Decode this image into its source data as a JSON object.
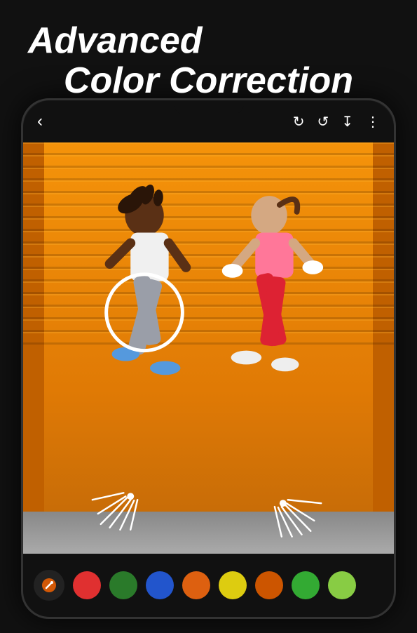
{
  "title": {
    "line1": "Advanced",
    "line2": "Color Correction"
  },
  "phone": {
    "back_icon": "‹",
    "toolbar": {
      "undo_icon": "↺",
      "redo_icon": "↻",
      "download_icon": "↓",
      "more_icon": "⋮"
    }
  },
  "color_palette": {
    "tool_icon": "✎",
    "colors": [
      {
        "name": "red",
        "hex": "#e03030"
      },
      {
        "name": "dark-green",
        "hex": "#2a7a2a"
      },
      {
        "name": "blue",
        "hex": "#2255cc"
      },
      {
        "name": "orange",
        "hex": "#dd6010"
      },
      {
        "name": "yellow",
        "hex": "#ddcc10"
      },
      {
        "name": "orange-red",
        "hex": "#cc5500"
      },
      {
        "name": "green",
        "hex": "#33aa33"
      },
      {
        "name": "light-green",
        "hex": "#88cc44"
      }
    ]
  },
  "annotations": {
    "circle_visible": true,
    "radial_lines_visible": true
  }
}
